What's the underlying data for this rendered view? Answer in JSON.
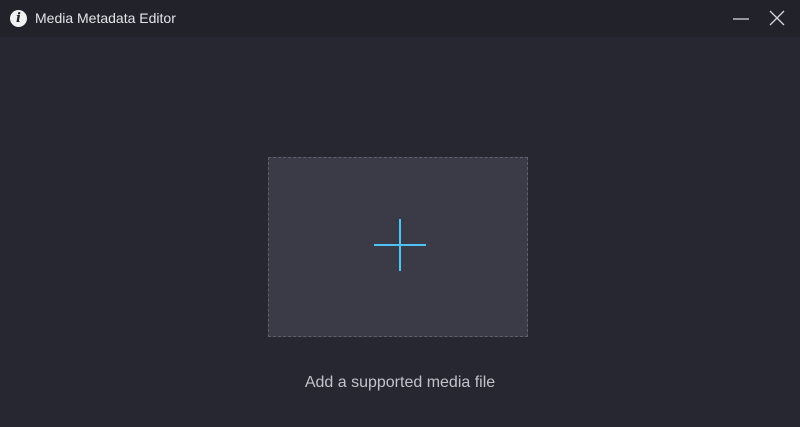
{
  "window": {
    "title": "Media Metadata Editor",
    "app_icon": "info-icon",
    "app_icon_glyph": "i",
    "controls": {
      "minimize_icon": "minimize-icon",
      "close_icon": "close-icon"
    }
  },
  "drop_zone": {
    "icon": "plus-icon",
    "hint": "Add a supported media file"
  },
  "colors": {
    "background": "#262730",
    "titlebar": "#21222a",
    "drop_zone": "#3a3b47",
    "accent": "#4fc3f7",
    "text": "#c2c3c9"
  }
}
